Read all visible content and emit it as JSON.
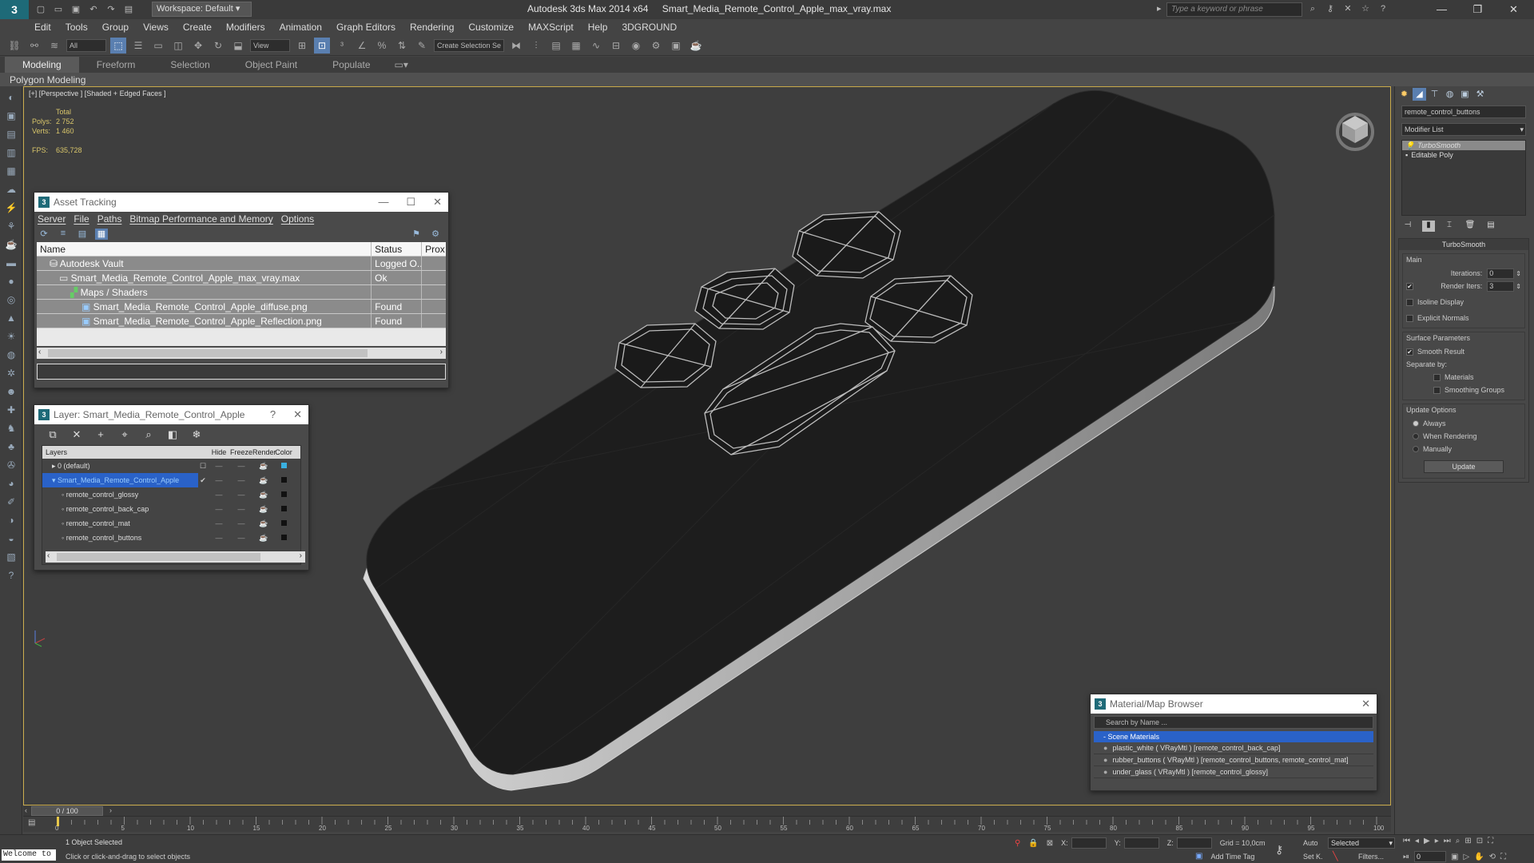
{
  "titlebar": {
    "app_logo": "3",
    "workspace": "Workspace: Default",
    "app_title": "Autodesk 3ds Max  2014 x64",
    "file_title": "Smart_Media_Remote_Control_Apple_max_vray.max",
    "search_placeholder": "Type a keyword or phrase"
  },
  "menu": [
    "Edit",
    "Tools",
    "Group",
    "Views",
    "Create",
    "Modifiers",
    "Animation",
    "Graph Editors",
    "Rendering",
    "Customize",
    "MAXScript",
    "Help",
    "3DGROUND"
  ],
  "toolbar": {
    "filter_value": "All",
    "refcoord_value": "View",
    "selection_set_placeholder": "Create Selection Se"
  },
  "ribbon": {
    "tabs": [
      "Modeling",
      "Freeform",
      "Selection",
      "Object Paint",
      "Populate"
    ],
    "active_tab": "Modeling",
    "subpanel": "Polygon Modeling"
  },
  "viewport": {
    "label": "[+] [Perspective ] [Shaded + Edged Faces ]",
    "stats_header": "Total",
    "polys_label": "Polys:",
    "polys_value": "2 752",
    "verts_label": "Verts:",
    "verts_value": "1 460",
    "fps_label": "FPS:",
    "fps_value": "635,728",
    "body_color": "#1c1c1c",
    "wire_color": "#b8b8b8"
  },
  "asset_tracking": {
    "title": "Asset Tracking",
    "menu": [
      "Server",
      "File",
      "Paths",
      "Bitmap Performance and Memory",
      "Options"
    ],
    "columns": [
      "Name",
      "Status",
      "Prox"
    ],
    "rows": [
      {
        "name": "Autodesk Vault",
        "status": "Logged O..."
      },
      {
        "name": "Smart_Media_Remote_Control_Apple_max_vray.max",
        "status": "Ok"
      },
      {
        "name": "Maps / Shaders",
        "status": ""
      },
      {
        "name": "Smart_Media_Remote_Control_Apple_diffuse.png",
        "status": "Found"
      },
      {
        "name": "Smart_Media_Remote_Control_Apple_Reflection.png",
        "status": "Found"
      }
    ]
  },
  "layer_dialog": {
    "title": "Layer: Smart_Media_Remote_Control_Apple",
    "help": "?",
    "columns": [
      "Layers",
      "Hide",
      "Freeze",
      "Render",
      "Color"
    ],
    "layers": [
      {
        "name": "0 (default)",
        "color": "#3ab0e0"
      },
      {
        "name": "Smart_Media_Remote_Control_Apple",
        "color": "#111111"
      },
      {
        "name": "remote_control_glossy",
        "color": "#111111"
      },
      {
        "name": "remote_control_back_cap",
        "color": "#111111"
      },
      {
        "name": "remote_control_mat",
        "color": "#111111"
      },
      {
        "name": "remote_control_buttons",
        "color": "#111111"
      }
    ]
  },
  "material_browser": {
    "title": "Material/Map Browser",
    "search_placeholder": "Search by Name ...",
    "group": "- Scene Materials",
    "items": [
      "plastic_white ( VRayMtl ) [remote_control_back_cap]",
      "rubber_buttons ( VRayMtl ) [remote_control_buttons, remote_control_mat]",
      "under_glass ( VRayMtl ) [remote_control_glossy]"
    ]
  },
  "command_panel": {
    "object_name": "remote_control_buttons",
    "modifier_list": "Modifier List",
    "stack": [
      "TurboSmooth",
      "Editable Poly"
    ],
    "turbosmooth": {
      "title": "TurboSmooth",
      "main": "Main",
      "iterations_label": "Iterations:",
      "iterations_value": "0",
      "render_iters_label": "Render Iters:",
      "render_iters_value": "3",
      "isoline": "Isoline Display",
      "explicit_normals": "Explicit Normals",
      "surface_params": "Surface Parameters",
      "smooth_result": "Smooth Result",
      "separate_by": "Separate by:",
      "materials": "Materials",
      "smoothing_groups": "Smoothing Groups",
      "update_options": "Update Options",
      "always": "Always",
      "when_rendering": "When Rendering",
      "manually": "Manually",
      "update_button": "Update"
    }
  },
  "timeline": {
    "slider_label": "0 / 100",
    "ticks": [
      "0",
      "5",
      "10",
      "15",
      "20",
      "25",
      "30",
      "35",
      "40",
      "45",
      "50",
      "55",
      "60",
      "65",
      "70",
      "75",
      "80",
      "85",
      "90",
      "95",
      "100"
    ]
  },
  "status": {
    "maxscript": "Welcome to",
    "selection": "1 Object Selected",
    "prompt": "Click or click-and-drag to select objects",
    "x_label": "X:",
    "y_label": "Y:",
    "z_label": "Z:",
    "grid": "Grid = 10,0cm",
    "add_time_tag": "Add Time Tag",
    "auto": "Auto",
    "set_key": "Set K.",
    "selected_dd": "Selected",
    "filters": "Filters...",
    "frame_value": "0"
  }
}
